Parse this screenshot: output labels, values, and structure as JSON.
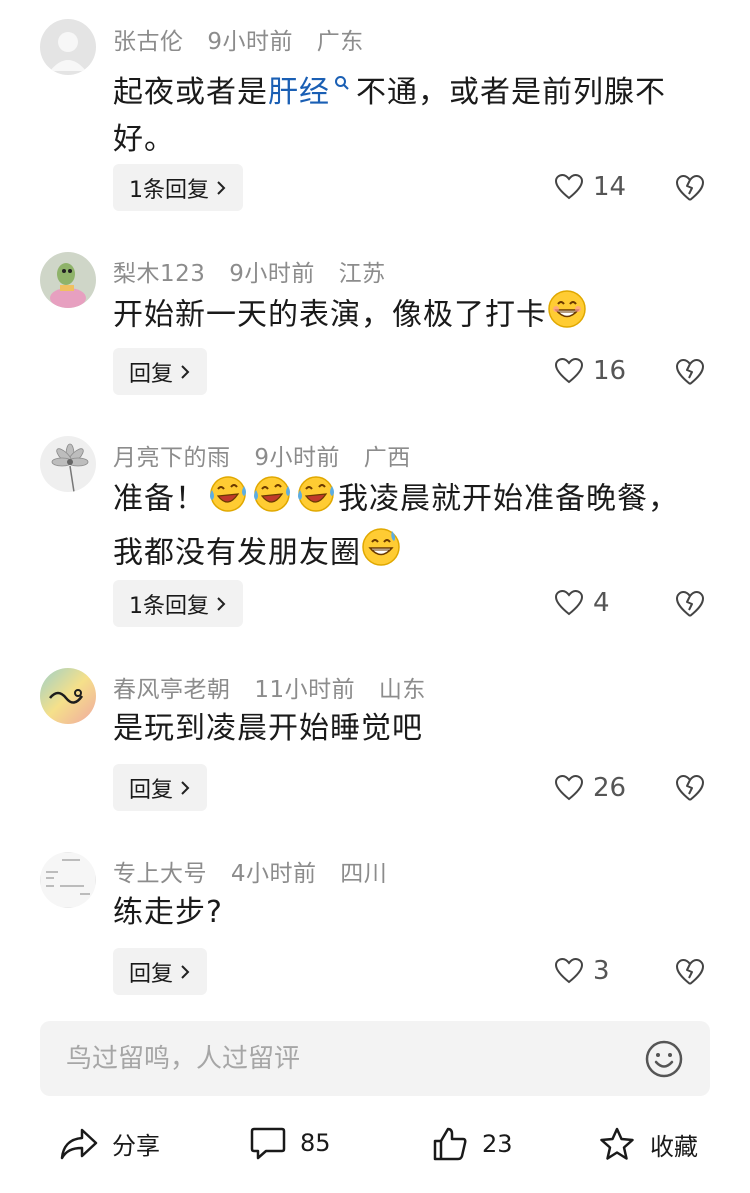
{
  "comments": [
    {
      "username": "张古伦",
      "time": "9小时前",
      "location": "广东",
      "text_before": "起夜或者是",
      "link_text": "肝经",
      "text_after": "不通，或者是前列腺不好。",
      "reply_label": "1条回复",
      "likes": "14"
    },
    {
      "username": "梨木123",
      "time": "9小时前",
      "location": "江苏",
      "text": "开始新一天的表演，像极了打卡",
      "reply_label": "回复",
      "likes": "16"
    },
    {
      "username": "月亮下的雨",
      "time": "9小时前",
      "location": "广西",
      "text_a": "准备！",
      "text_b": "我凌晨就开始准备晚餐，",
      "text_c": "我都没有发朋友圈",
      "reply_label": "1条回复",
      "likes": "4"
    },
    {
      "username": "春风亭老朝",
      "time": "11小时前",
      "location": "山东",
      "text": "是玩到凌晨开始睡觉吧",
      "reply_label": "回复",
      "likes": "26"
    },
    {
      "username": "专上大号",
      "time": "4小时前",
      "location": "四川",
      "text": "练走步?",
      "reply_label": "回复",
      "likes": "3"
    }
  ],
  "input": {
    "placeholder": "鸟过留鸣，人过留评"
  },
  "bottom_bar": {
    "share_label": "分享",
    "comment_count": "85",
    "like_count": "23",
    "favorite_label": "收藏"
  },
  "colors": {
    "link": "#1a5fb4",
    "meta": "#8c8c8c",
    "input_bg": "#f3f3f3",
    "reply_bg": "#f2f2f2"
  }
}
